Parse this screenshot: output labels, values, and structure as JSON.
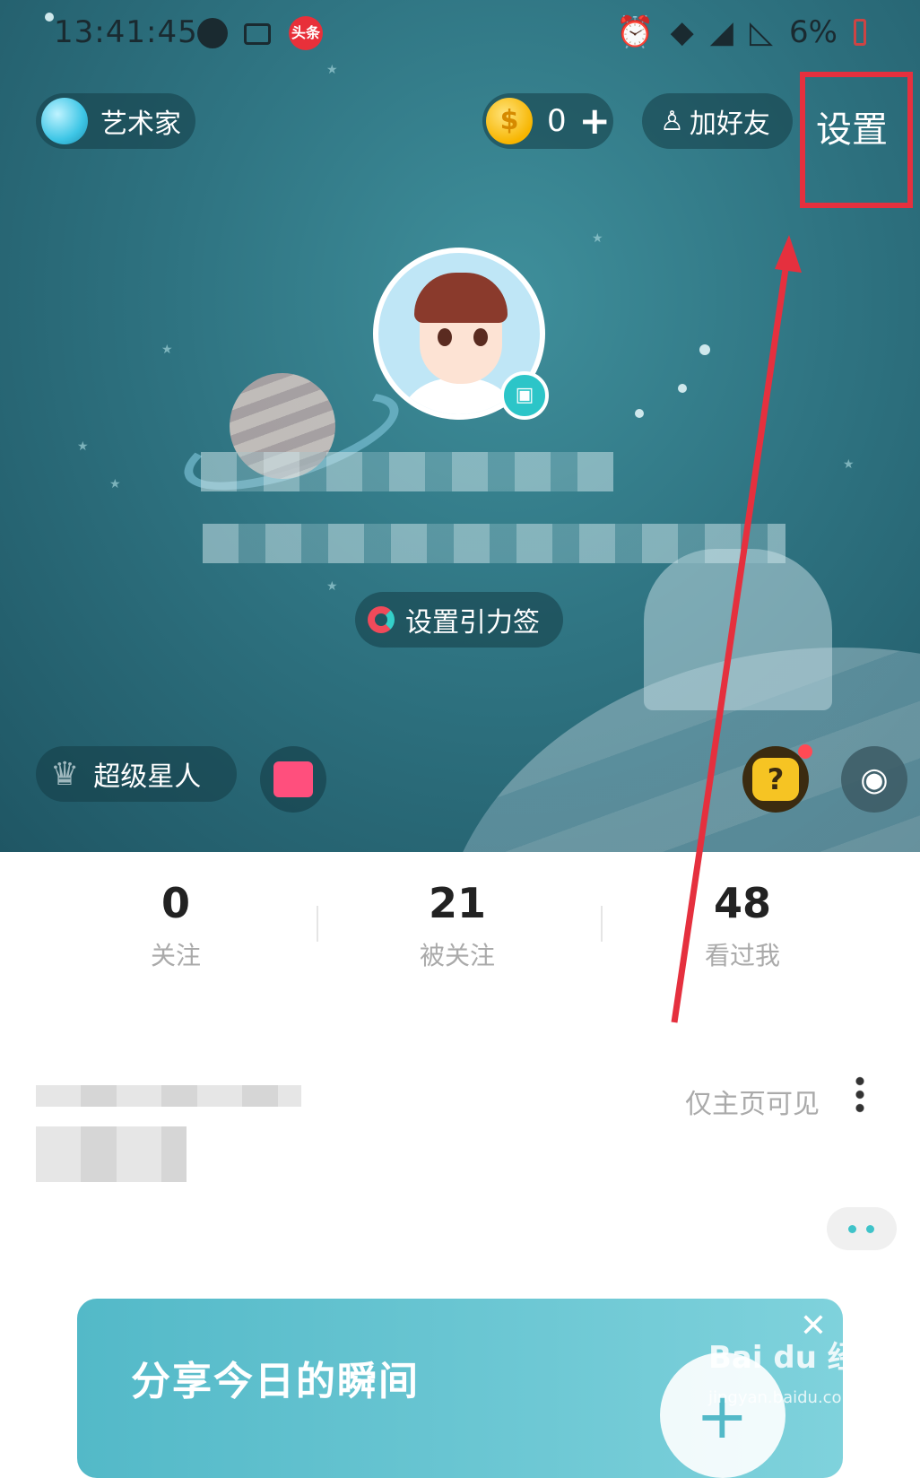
{
  "status_bar": {
    "time": "13:41:45",
    "battery": "6%",
    "toutiao_label": "头条"
  },
  "header": {
    "role_label": "艺术家",
    "coin_count": "0",
    "coin_plus": "+",
    "add_friend_label": "加好友",
    "settings_label": "设置"
  },
  "profile": {
    "gravity_tag_label": "设置引力签",
    "super_star_label": "超级星人"
  },
  "stats": [
    {
      "value": "0",
      "label": "关注"
    },
    {
      "value": "21",
      "label": "被关注"
    },
    {
      "value": "48",
      "label": "看过我"
    }
  ],
  "post": {
    "visibility": "仅主页可见"
  },
  "banner": {
    "title": "分享今日的瞬间"
  },
  "watermark": {
    "brand": "Bai du 经验",
    "url": "jingyan.baidu.com"
  },
  "colors": {
    "highlight_red": "#e5303e",
    "hero_teal": "#2f7482",
    "accent_teal": "#3fc3c9"
  },
  "icons": [
    "alarm-icon",
    "wifi-icon",
    "signal-icon",
    "battery-icon",
    "coin-icon",
    "add-person-icon",
    "gift-icon",
    "question-cat-icon",
    "mic-icon",
    "more-vertical-icon",
    "close-icon",
    "plus-icon"
  ]
}
